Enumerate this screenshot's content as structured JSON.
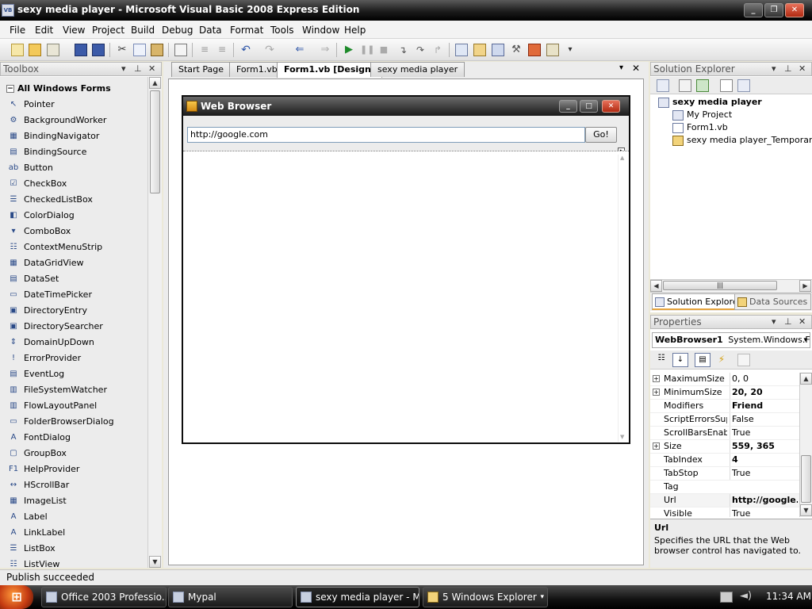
{
  "window": {
    "title": "sexy media player - Microsoft Visual Basic 2008 Express Edition",
    "icon_text": "VB"
  },
  "menu": [
    "File",
    "Edit",
    "View",
    "Project",
    "Build",
    "Debug",
    "Data",
    "Format",
    "Tools",
    "Window",
    "Help"
  ],
  "toolbox": {
    "title": "Toolbox",
    "group": "All Windows Forms",
    "items": [
      {
        "label": "Pointer",
        "icon": "pointer-icon",
        "glyph": "↖"
      },
      {
        "label": "BackgroundWorker",
        "icon": "background-worker-icon",
        "glyph": "⚙"
      },
      {
        "label": "BindingNavigator",
        "icon": "binding-navigator-icon",
        "glyph": "▦"
      },
      {
        "label": "BindingSource",
        "icon": "binding-source-icon",
        "glyph": "▤"
      },
      {
        "label": "Button",
        "icon": "button-icon",
        "glyph": "ab"
      },
      {
        "label": "CheckBox",
        "icon": "checkbox-icon",
        "glyph": "☑"
      },
      {
        "label": "CheckedListBox",
        "icon": "checked-listbox-icon",
        "glyph": "☰"
      },
      {
        "label": "ColorDialog",
        "icon": "color-dialog-icon",
        "glyph": "◧"
      },
      {
        "label": "ComboBox",
        "icon": "combobox-icon",
        "glyph": "▾"
      },
      {
        "label": "ContextMenuStrip",
        "icon": "context-menu-strip-icon",
        "glyph": "☷"
      },
      {
        "label": "DataGridView",
        "icon": "datagridview-icon",
        "glyph": "▦"
      },
      {
        "label": "DataSet",
        "icon": "dataset-icon",
        "glyph": "▤"
      },
      {
        "label": "DateTimePicker",
        "icon": "datetimepicker-icon",
        "glyph": "▭"
      },
      {
        "label": "DirectoryEntry",
        "icon": "directory-entry-icon",
        "glyph": "▣"
      },
      {
        "label": "DirectorySearcher",
        "icon": "directory-searcher-icon",
        "glyph": "▣"
      },
      {
        "label": "DomainUpDown",
        "icon": "domain-updown-icon",
        "glyph": "⇕"
      },
      {
        "label": "ErrorProvider",
        "icon": "error-provider-icon",
        "glyph": "!"
      },
      {
        "label": "EventLog",
        "icon": "eventlog-icon",
        "glyph": "▤"
      },
      {
        "label": "FileSystemWatcher",
        "icon": "filesystemwatcher-icon",
        "glyph": "▥"
      },
      {
        "label": "FlowLayoutPanel",
        "icon": "flowlayoutpanel-icon",
        "glyph": "▥"
      },
      {
        "label": "FolderBrowserDialog",
        "icon": "folderbrowserdialog-icon",
        "glyph": "▭"
      },
      {
        "label": "FontDialog",
        "icon": "fontdialog-icon",
        "glyph": "A"
      },
      {
        "label": "GroupBox",
        "icon": "groupbox-icon",
        "glyph": "▢"
      },
      {
        "label": "HelpProvider",
        "icon": "helpprovider-icon",
        "glyph": "F1"
      },
      {
        "label": "HScrollBar",
        "icon": "hscrollbar-icon",
        "glyph": "↔"
      },
      {
        "label": "ImageList",
        "icon": "imagelist-icon",
        "glyph": "▦"
      },
      {
        "label": "Label",
        "icon": "label-icon",
        "glyph": "A"
      },
      {
        "label": "LinkLabel",
        "icon": "linklabel-icon",
        "glyph": "A"
      },
      {
        "label": "ListBox",
        "icon": "listbox-icon",
        "glyph": "☰"
      },
      {
        "label": "ListView",
        "icon": "listview-icon",
        "glyph": "☷"
      }
    ]
  },
  "tabs": [
    {
      "label": "Start Page",
      "active": false
    },
    {
      "label": "Form1.vb",
      "active": false
    },
    {
      "label": "Form1.vb [Design]",
      "active": true
    },
    {
      "label": "sexy media player",
      "active": false
    }
  ],
  "form": {
    "title": "Web Browser",
    "url_value": "http://google.com",
    "go_label": "Go!"
  },
  "solution_explorer": {
    "title": "Solution Explorer",
    "root": "sexy media player",
    "children": [
      "My Project",
      "Form1.vb",
      "sexy media player_TemporaryKe"
    ],
    "subtabs": [
      "Solution Explorer",
      "Data Sources"
    ]
  },
  "properties": {
    "title": "Properties",
    "object_name": "WebBrowser1",
    "object_type": "System.Windows.For",
    "rows": [
      {
        "name": "MaximumSize",
        "value": "0, 0",
        "expandable": true,
        "bold": false
      },
      {
        "name": "MinimumSize",
        "value": "20, 20",
        "expandable": true,
        "bold": true
      },
      {
        "name": "Modifiers",
        "value": "Friend",
        "expandable": false,
        "bold": true
      },
      {
        "name": "ScriptErrorsSupp",
        "value": "False",
        "expandable": false,
        "bold": false
      },
      {
        "name": "ScrollBarsEnable",
        "value": "True",
        "expandable": false,
        "bold": false
      },
      {
        "name": "Size",
        "value": "559, 365",
        "expandable": true,
        "bold": true
      },
      {
        "name": "TabIndex",
        "value": "4",
        "expandable": false,
        "bold": true
      },
      {
        "name": "TabStop",
        "value": "True",
        "expandable": false,
        "bold": false
      },
      {
        "name": "Tag",
        "value": "",
        "expandable": false,
        "bold": false
      },
      {
        "name": "Url",
        "value": "http://google.c",
        "expandable": false,
        "bold": true
      },
      {
        "name": "Visible",
        "value": "True",
        "expandable": false,
        "bold": false
      }
    ],
    "desc_title": "Url",
    "desc_text": "Specifies the URL that the Web browser control has navigated to."
  },
  "status": "Publish succeeded",
  "taskbar": {
    "tasks": [
      {
        "label": "Office 2003 Professio..."
      },
      {
        "label": "Mypal"
      },
      {
        "label": "sexy media player - Mi..."
      },
      {
        "label": "5 Windows Explorer"
      }
    ],
    "clock": "11:34 AM"
  }
}
